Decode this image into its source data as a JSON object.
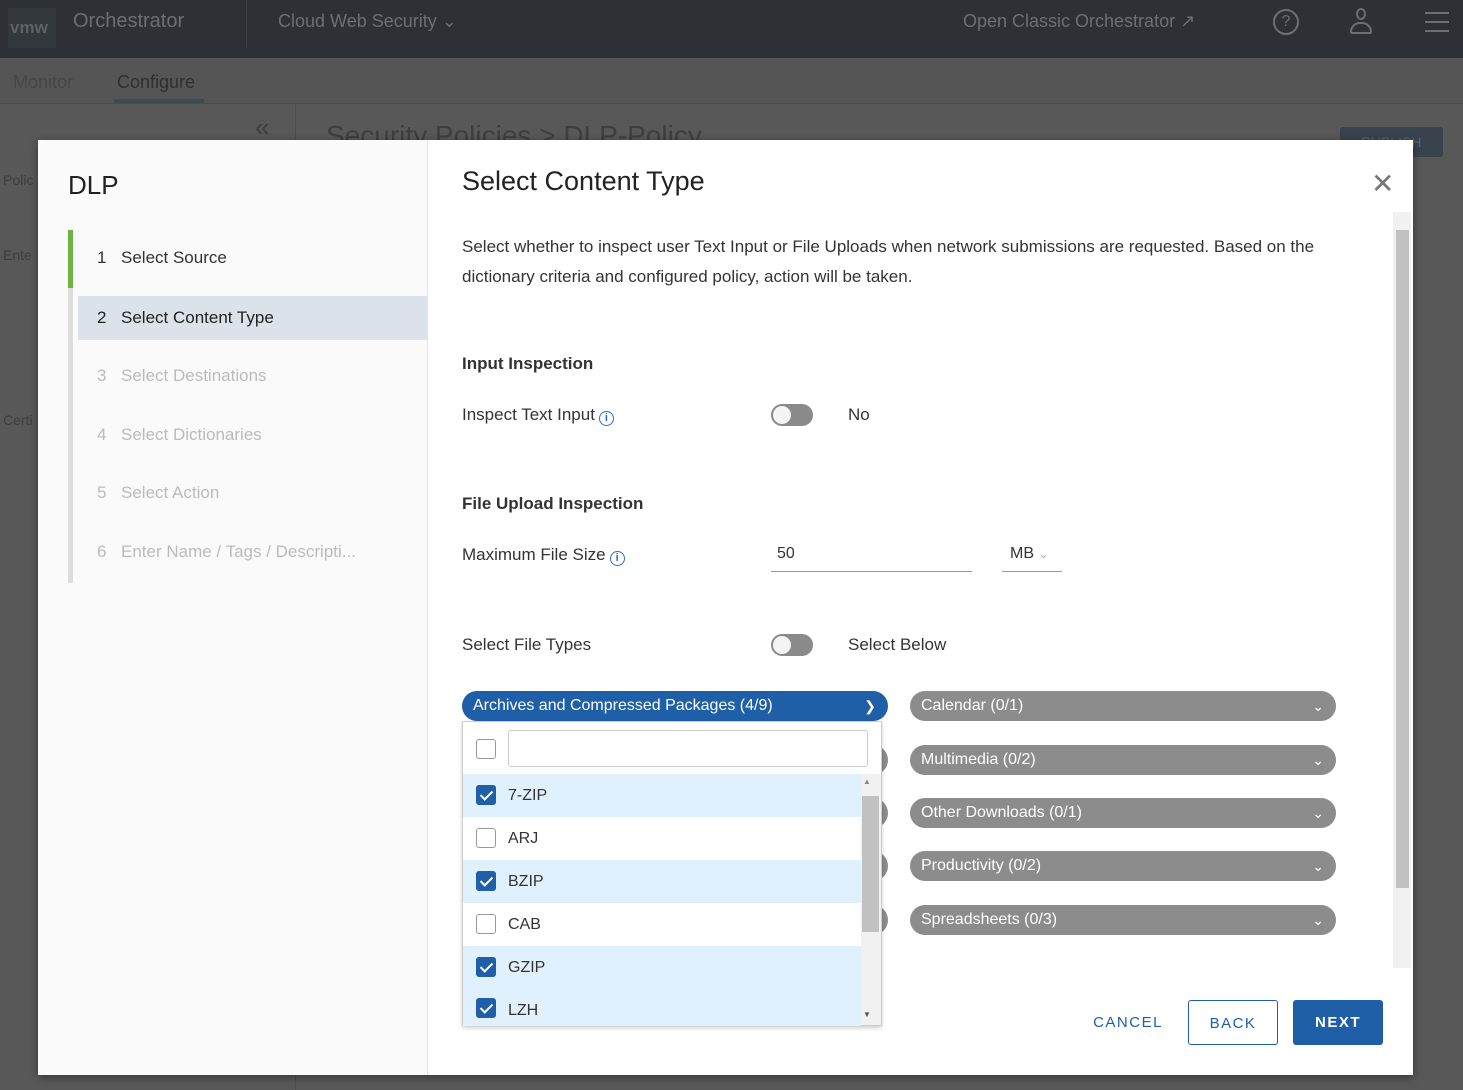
{
  "topbar": {
    "logo": "vmw",
    "app": "Orchestrator",
    "product": "Cloud Web Security",
    "classic": "Open Classic Orchestrator"
  },
  "nav": {
    "tabs": [
      "Monitor",
      "Configure"
    ],
    "active": "Configure"
  },
  "bg": {
    "breadcrumb": "Security Policies > DLP-Policy",
    "publish": "PUBLISH",
    "side": [
      "Polic",
      "Ente",
      "Certi"
    ]
  },
  "wizard": {
    "title": "DLP",
    "steps": [
      {
        "n": "1",
        "label": "Select Source",
        "state": "done"
      },
      {
        "n": "2",
        "label": "Select Content Type",
        "state": "active"
      },
      {
        "n": "3",
        "label": "Select Destinations",
        "state": "pending"
      },
      {
        "n": "4",
        "label": "Select Dictionaries",
        "state": "pending"
      },
      {
        "n": "5",
        "label": "Select Action",
        "state": "pending"
      },
      {
        "n": "6",
        "label": "Enter Name / Tags / Descripti...",
        "state": "pending"
      }
    ]
  },
  "main": {
    "title": "Select Content Type",
    "description": "Select whether to inspect user Text Input or File Uploads when network submissions are requested. Based on the dictionary criteria and configured policy, action will be taken.",
    "input_section": "Input Inspection",
    "inspect_text_label": "Inspect Text Input",
    "inspect_text_value": "No",
    "inspect_text_on": false,
    "file_section": "File Upload Inspection",
    "max_size_label": "Maximum File Size",
    "max_size_value": "50",
    "max_size_unit": "MB",
    "file_types_label": "Select File Types",
    "file_types_value": "Select Below",
    "file_types_on": false,
    "categories_open": "Archives and Compressed Packages (4/9)",
    "categories_right": [
      "Calendar (0/1)",
      "Multimedia (0/2)",
      "Other Downloads (0/1)",
      "Productivity (0/2)",
      "Spreadsheets (0/3)"
    ],
    "dropdown": {
      "search_value": "",
      "items": [
        {
          "label": "7-ZIP",
          "checked": true
        },
        {
          "label": "ARJ",
          "checked": false
        },
        {
          "label": "BZIP",
          "checked": true
        },
        {
          "label": "CAB",
          "checked": false
        },
        {
          "label": "GZIP",
          "checked": true
        },
        {
          "label": "LZH",
          "checked": true
        }
      ]
    }
  },
  "footer": {
    "cancel": "CANCEL",
    "back": "BACK",
    "next": "NEXT"
  },
  "colors": {
    "accent": "#1e5fa8",
    "step_done": "#6db33f",
    "chip": "#8c8c8c"
  }
}
